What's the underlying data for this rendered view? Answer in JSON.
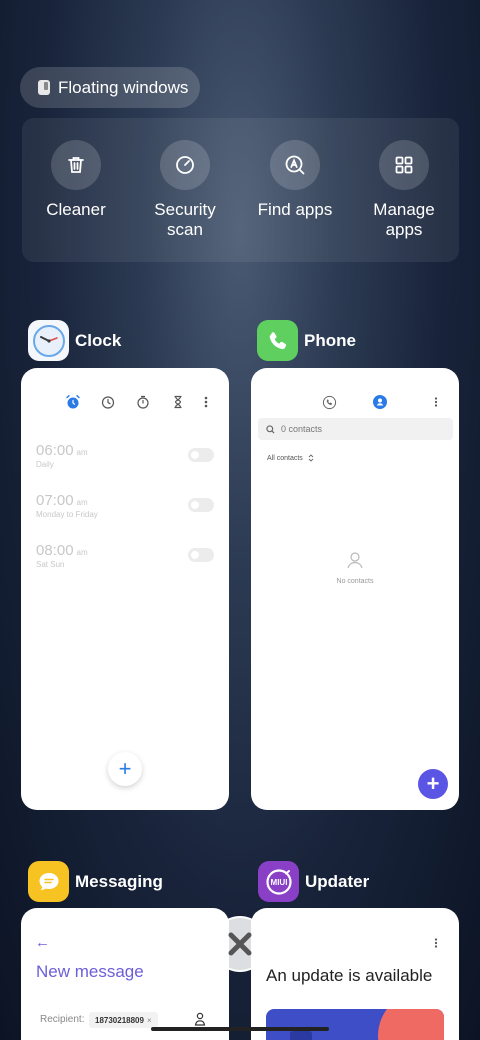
{
  "floating": {
    "label": "Floating windows"
  },
  "tools": [
    {
      "label": "Cleaner",
      "icon": "trash-icon"
    },
    {
      "label": "Security scan",
      "icon": "security-scan-icon"
    },
    {
      "label": "Find apps",
      "icon": "find-apps-icon"
    },
    {
      "label": "Manage apps",
      "icon": "manage-apps-icon"
    }
  ],
  "apps": {
    "clock": {
      "name": "Clock",
      "alarms": [
        {
          "time": "06:00",
          "ampm": "am",
          "repeat": "Daily"
        },
        {
          "time": "07:00",
          "ampm": "am",
          "repeat": "Monday to Friday"
        },
        {
          "time": "08:00",
          "ampm": "am",
          "repeat": "Sat Sun"
        }
      ],
      "fab": "+"
    },
    "phone": {
      "name": "Phone",
      "search_placeholder": "0 contacts",
      "filter": "All contacts",
      "empty": "No contacts",
      "fab": "+"
    },
    "messaging": {
      "name": "Messaging",
      "back": "←",
      "title": "New message",
      "recipient_label": "Recipient:",
      "recipient_chip": "18730218809",
      "chip_close": "×"
    },
    "updater": {
      "name": "Updater",
      "logo_text": "MIUI",
      "title": "An update is available"
    }
  },
  "colors": {
    "accent_blue": "#2a7ae8",
    "phone_green": "#5fd05f",
    "messaging_yellow": "#f7c323",
    "updater_purple": "#8a3fc7",
    "messaging_purple": "#6a5fd8",
    "fab_purple": "#5b55e6"
  }
}
